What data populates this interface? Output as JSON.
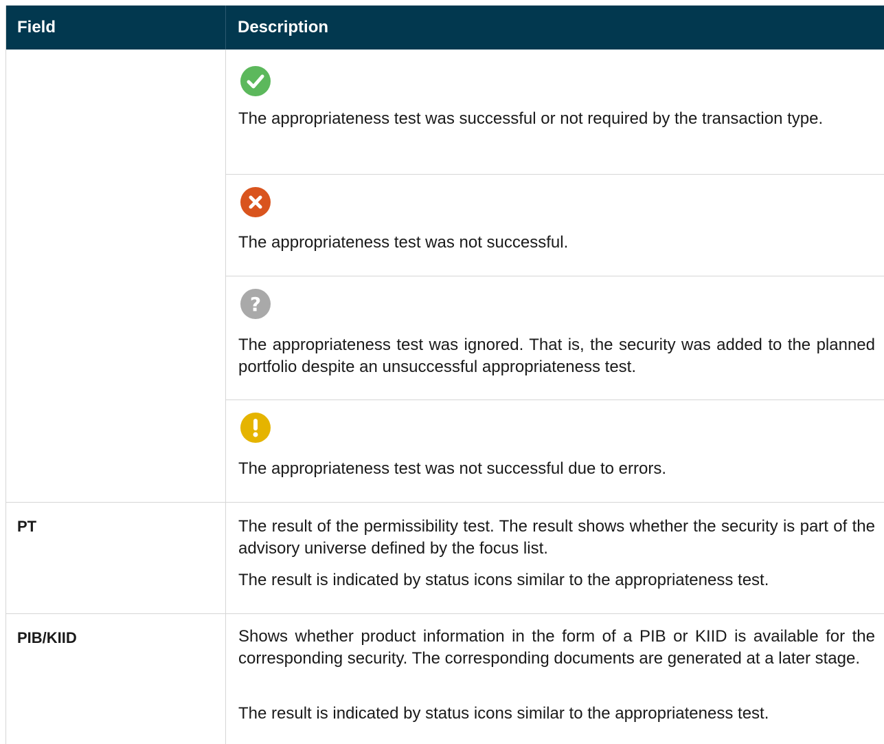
{
  "header": {
    "field": "Field",
    "description": "Description"
  },
  "status_rows": [
    {
      "icon": "check-circle-icon",
      "color": "#5cb85c",
      "text": "The appropriateness test was successful or not required by the transaction type."
    },
    {
      "icon": "error-circle-icon",
      "color": "#d9541e",
      "text": "The appropriateness test was not successful."
    },
    {
      "icon": "question-circle-icon",
      "color": "#a9a9a9",
      "text": "The appropriateness test was ignored. That is, the security was added to the planned portfolio despite an unsuccessful appropriateness test."
    },
    {
      "icon": "warning-circle-icon",
      "color": "#e5b400",
      "text": "The appropriateness test was not successful due to errors."
    }
  ],
  "rows": [
    {
      "field": "PT",
      "p1": "The result of the permissibility test. The result shows whether the security is part of the advisory universe defined by the focus list.",
      "p2": "The result is indicated by status icons similar to the appropriateness test."
    },
    {
      "field": "PIB/KIID",
      "p1": "Shows whether product information in the form of a PIB or KIID is available for the corresponding security. The corresponding documents are generated at a later stage.",
      "p2": "The result is indicated by status icons similar to the appropriateness test."
    }
  ],
  "colors": {
    "header_bg": "#02384f",
    "header_text": "#ffffff",
    "grid": "#d6d6d6"
  }
}
